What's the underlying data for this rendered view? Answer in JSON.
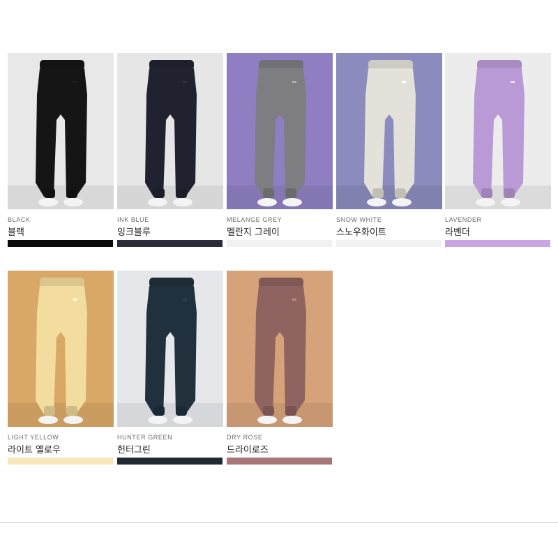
{
  "colors": [
    {
      "en": "BLACK",
      "ko": "블랙",
      "swatch": "#0b0b0b",
      "bg": "#e8e8e8",
      "pants": "#151515"
    },
    {
      "en": "INK BLUE",
      "ko": "잉크블루",
      "swatch": "#2a2c3a",
      "bg": "#e6e6e6",
      "pants": "#20222f"
    },
    {
      "en": "MELANGE GREY",
      "ko": "멜란지 그레이",
      "swatch": "#f1f1f1",
      "bg": "#8f7fc2",
      "pants": "#7e7e82"
    },
    {
      "en": "SNOW WHITE",
      "ko": "스노우화이트",
      "swatch": "#f1f1f1",
      "bg": "#8b8bbd",
      "pants": "#e4e1da"
    },
    {
      "en": "LAVENDER",
      "ko": "라벤더",
      "swatch": "#c9a6e3",
      "bg": "#ececec",
      "pants": "#b99ad6"
    },
    {
      "en": "LIGHT YELLOW",
      "ko": "라이트 옐로우",
      "swatch": "#f9e6bd",
      "bg": "#d9a867",
      "pants": "#f2dc9e"
    },
    {
      "en": "HUNTER GREEN",
      "ko": "헌터그린",
      "swatch": "#1f2a33",
      "bg": "#e6e7ea",
      "pants": "#20303d"
    },
    {
      "en": "DRY ROSE",
      "ko": "드라이로즈",
      "swatch": "#a97677",
      "bg": "#d6a27a",
      "pants": "#8e6360"
    }
  ]
}
